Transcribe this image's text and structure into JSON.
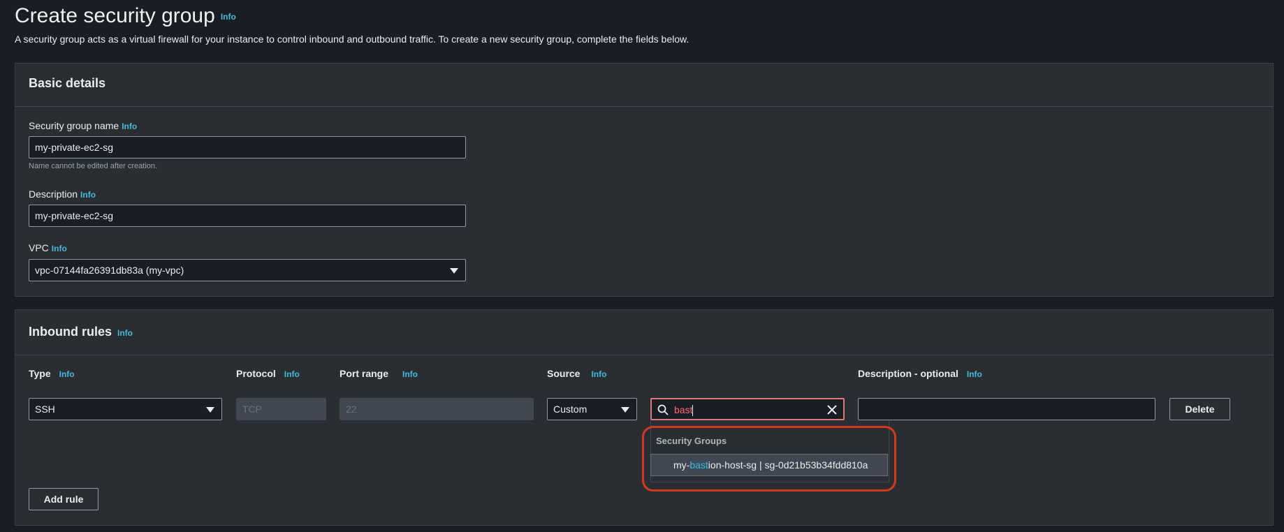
{
  "header": {
    "title": "Create security group",
    "info": "Info",
    "subtitle": "A security group acts as a virtual firewall for your instance to control inbound and outbound traffic. To create a new security group, complete the fields below."
  },
  "basic": {
    "title": "Basic details",
    "name_label": "Security group name",
    "name_info": "Info",
    "name_value": "my-private-ec2-sg",
    "name_hint": "Name cannot be edited after creation.",
    "desc_label": "Description",
    "desc_info": "Info",
    "desc_value": "my-private-ec2-sg",
    "vpc_label": "VPC",
    "vpc_info": "Info",
    "vpc_value": "vpc-07144fa26391db83a (my-vpc)"
  },
  "inbound": {
    "title": "Inbound rules",
    "info": "Info",
    "columns": {
      "type": "Type",
      "protocol": "Protocol",
      "port_range": "Port range",
      "source": "Source",
      "description": "Description - optional",
      "info": "Info"
    },
    "row": {
      "type": "SSH",
      "protocol": "TCP",
      "port_range": "22",
      "source_type": "Custom",
      "search_value": "bast",
      "description_value": "",
      "delete_label": "Delete"
    },
    "dropdown": {
      "group_label": "Security Groups",
      "item_prefix": "my-",
      "item_match": "bast",
      "item_suffix": "ion-host-sg | sg-0d21b53b34fdd810a"
    },
    "add_rule_label": "Add rule"
  },
  "colors": {
    "background": "#1a1d23",
    "panel": "#2a2e33",
    "accent": "#44b9d6",
    "callout": "#d23a1e",
    "search_border": "#e07a7a"
  }
}
